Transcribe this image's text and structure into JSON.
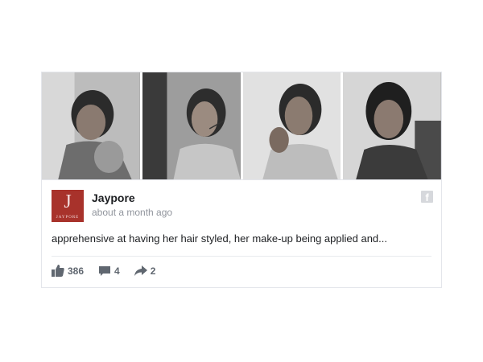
{
  "post": {
    "page_name": "Jaypore",
    "timestamp": "about a month ago",
    "text": "apprehensive at having her hair styled, her make-up being applied and...",
    "avatar": {
      "monogram": "J",
      "wordmark": "JAYPORE",
      "color": "#a8322b"
    },
    "source_icon": "facebook-icon"
  },
  "photos": [
    {
      "icon": "photo-1"
    },
    {
      "icon": "photo-2"
    },
    {
      "icon": "photo-3"
    },
    {
      "icon": "photo-4"
    }
  ],
  "reactions": {
    "likes": "386",
    "comments": "4",
    "shares": "2",
    "icons": [
      "like-icon",
      "comment-icon",
      "share-icon"
    ]
  }
}
